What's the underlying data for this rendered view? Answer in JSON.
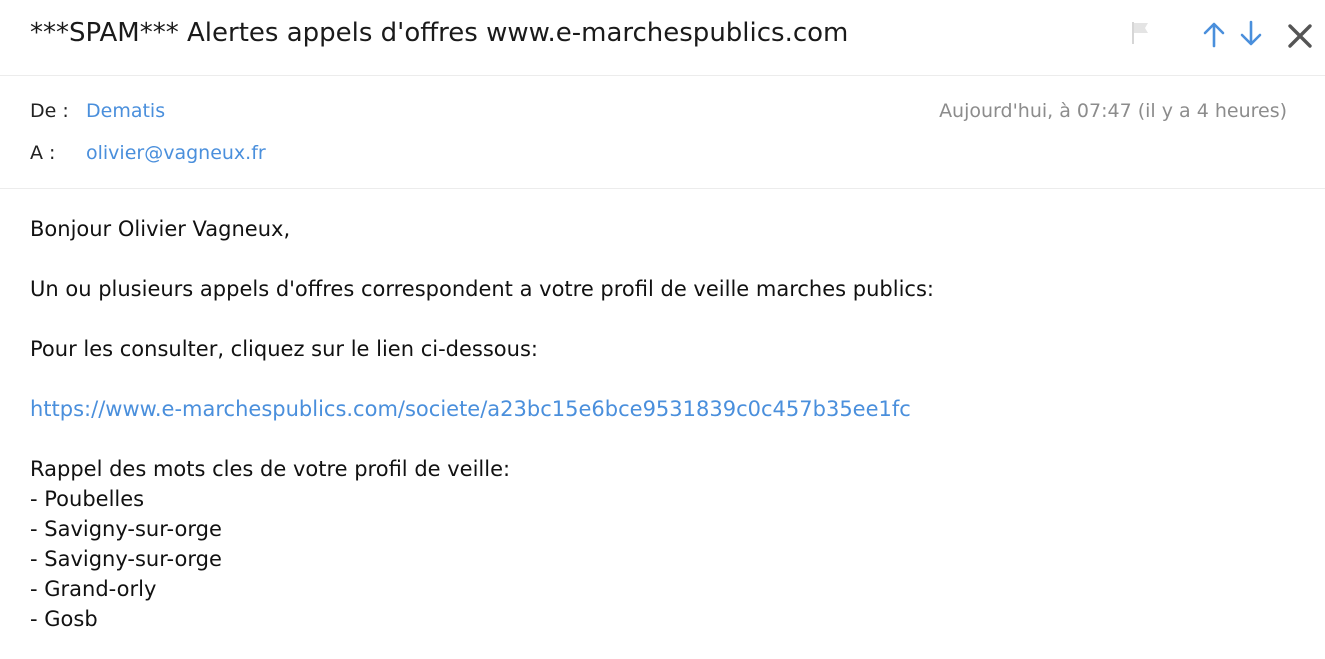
{
  "header": {
    "subject": "***SPAM*** Alertes appels d'offres www.e-marchespublics.com",
    "icons": [
      "flag-icon",
      "arrow-up-icon",
      "arrow-down-icon",
      "close-icon"
    ]
  },
  "meta": {
    "from_label": "De :",
    "from_value": "Dematis",
    "to_label": "A :",
    "to_value": "olivier@vagneux.fr",
    "date": "Aujourd'hui, à 07:47 (il y a 4 heures)"
  },
  "body": {
    "greeting": "Bonjour Olivier Vagneux,",
    "line1": "Un ou plusieurs appels d'offres correspondent a votre profil de veille marches publics:",
    "line2": "Pour les consulter, cliquez sur le lien ci-dessous:",
    "link": "https://www.e-marchespublics.com/societe/a23bc15e6bce9531839c0c457b35ee1fc",
    "keywords_title": "Rappel des mots cles de votre profil de veille:",
    "keywords": [
      "- Poubelles",
      "- Savigny-sur-orge",
      "- Savigny-sur-orge",
      "- Grand-orly",
      "- Gosb"
    ]
  },
  "colors": {
    "accent": "#4a8fdc",
    "muted": "#8c8c8c",
    "divider": "#ececec"
  }
}
